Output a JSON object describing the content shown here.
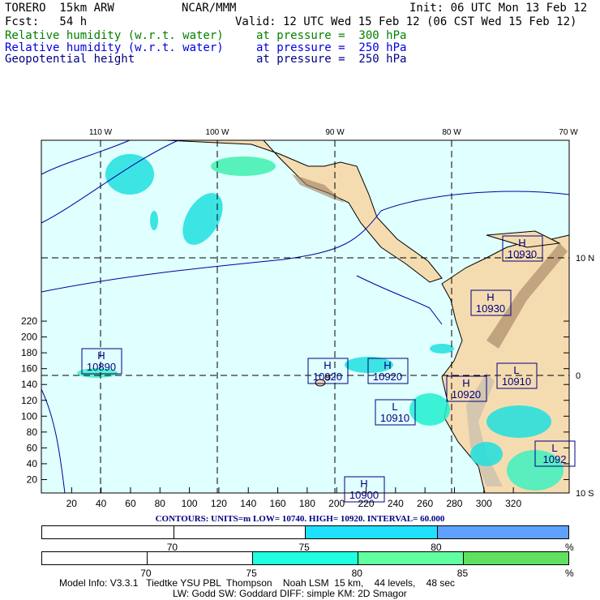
{
  "header": {
    "model": "TORERO  15km ARW",
    "org": "NCAR/MMM",
    "init": "Init: 06 UTC Mon 13 Feb 12",
    "fcst": "Fcst:   54 h",
    "valid": "Valid: 12 UTC Wed 15 Feb 12 (06 CST Wed 15 Feb 12)"
  },
  "fields": [
    {
      "name": "Relative humidity (w.r.t. water)",
      "level": "at pressure =  300 hPa",
      "color": "#008000"
    },
    {
      "name": "Relative humidity (w.r.t. water)",
      "level": "at pressure =  250 hPa",
      "color": "#0000e0"
    },
    {
      "name": "Geopotential height",
      "level": "at pressure =  250 hPa",
      "color": "#000080"
    }
  ],
  "map": {
    "lon_labels": [
      "110 W",
      "100 W",
      "90 W",
      "80 W",
      "70 W"
    ],
    "lat_labels": [
      "10 N",
      "0",
      "10 S"
    ],
    "x_ticks": [
      "20",
      "40",
      "60",
      "80",
      "100",
      "120",
      "140",
      "160",
      "180",
      "200",
      "220",
      "240",
      "260",
      "280",
      "300",
      "320"
    ],
    "y_ticks": [
      "20",
      "40",
      "60",
      "80",
      "100",
      "120",
      "140",
      "160",
      "180",
      "200",
      "220"
    ],
    "centers": [
      {
        "type": "H",
        "value": "10930"
      },
      {
        "type": "H",
        "value": "10930"
      },
      {
        "type": "H",
        "value": "10890"
      },
      {
        "type": "H",
        "value": "10920"
      },
      {
        "type": "H",
        "value": "10920"
      },
      {
        "type": "H",
        "value": "10920"
      },
      {
        "type": "L",
        "value": "10910"
      },
      {
        "type": "L",
        "value": "10910"
      },
      {
        "type": "L",
        "value": "1092"
      },
      {
        "type": "H",
        "value": "10900"
      }
    ]
  },
  "contours": "CONTOURS:  UNITS=m  LOW=  10740.      HIGH=  10920.      INTERVAL=    60.000",
  "colorbar1": {
    "colors": [
      "#ffffff",
      "#ffffff",
      "#20e0ff",
      "#60a0ff"
    ],
    "labels": [
      "70",
      "75",
      "80"
    ],
    "unit": "%"
  },
  "colorbar2": {
    "colors": [
      "#ffffff",
      "#ffffff",
      "#20ffe0",
      "#60ffa0",
      "#60e060"
    ],
    "labels": [
      "70",
      "75",
      "80",
      "85"
    ],
    "unit": "%"
  },
  "model_info": [
    "Model Info: V3.3.1   Tiedtke YSU PBL  Thompson    Noah LSM  15 km,    44 levels,    48 sec",
    "LW: Godd SW: Goddard DIFF: simple KM: 2D Smagor"
  ]
}
